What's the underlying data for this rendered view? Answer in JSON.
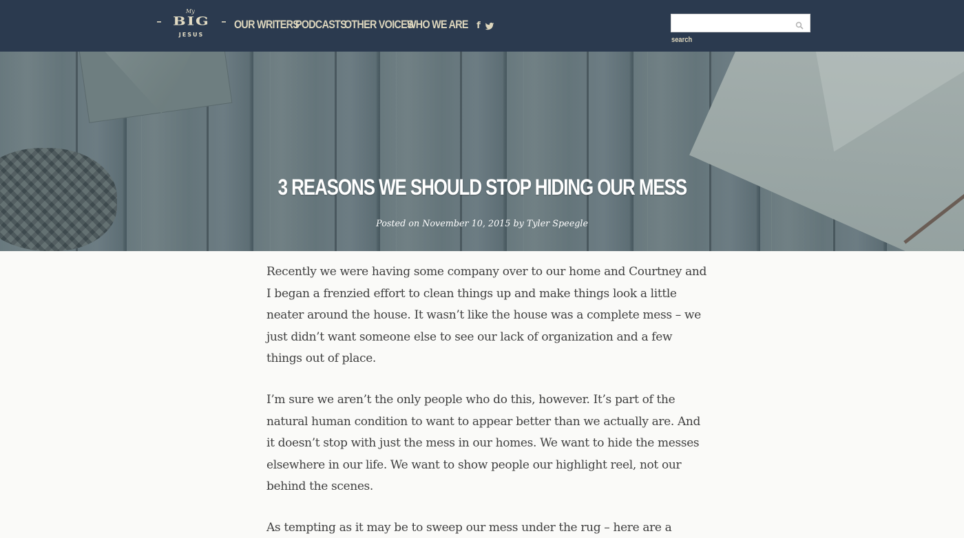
{
  "header": {
    "logo": {
      "small": "My",
      "big": "BIG",
      "sub": "JESUS"
    },
    "nav": [
      {
        "label": "OUR WRITERS"
      },
      {
        "label": "PODCASTS"
      },
      {
        "label": "OTHER VOICES"
      },
      {
        "label": "WHO WE ARE"
      }
    ],
    "social": [
      {
        "icon": "facebook-icon",
        "glyph": "f"
      },
      {
        "icon": "twitter-icon"
      }
    ],
    "search": {
      "value": "",
      "placeholder": "",
      "label": "search",
      "icon": "search-icon"
    }
  },
  "hero": {
    "title": "3 REASONS WE SHOULD STOP HIDING OUR MESS",
    "meta": "Posted on November 10, 2015 by Tyler Speegle"
  },
  "article": {
    "paragraphs": [
      "Recently we were having some company over to our home and Courtney and I began a frenzied effort to clean things up and make things look a little neater around the house. It wasn’t like the house was a complete mess – we just didn’t want someone else to see our lack of organization and a few things out of place.",
      "I’m sure we aren’t the only people who do this, however. It’s part of the natural human condition to want to appear better than we actually are. And it doesn’t stop with just the mess in our homes. We want to hide the messes elsewhere in our life. We want to show people our highlight reel, not our behind the scenes.",
      "As tempting as it may be to sweep our mess under the rug – here are a"
    ]
  },
  "colors": {
    "header_bg": "#2b3a4f",
    "nav_text": "#ddd6bd",
    "body_bg": "#fafaf8",
    "body_text": "#3f3f3f"
  }
}
